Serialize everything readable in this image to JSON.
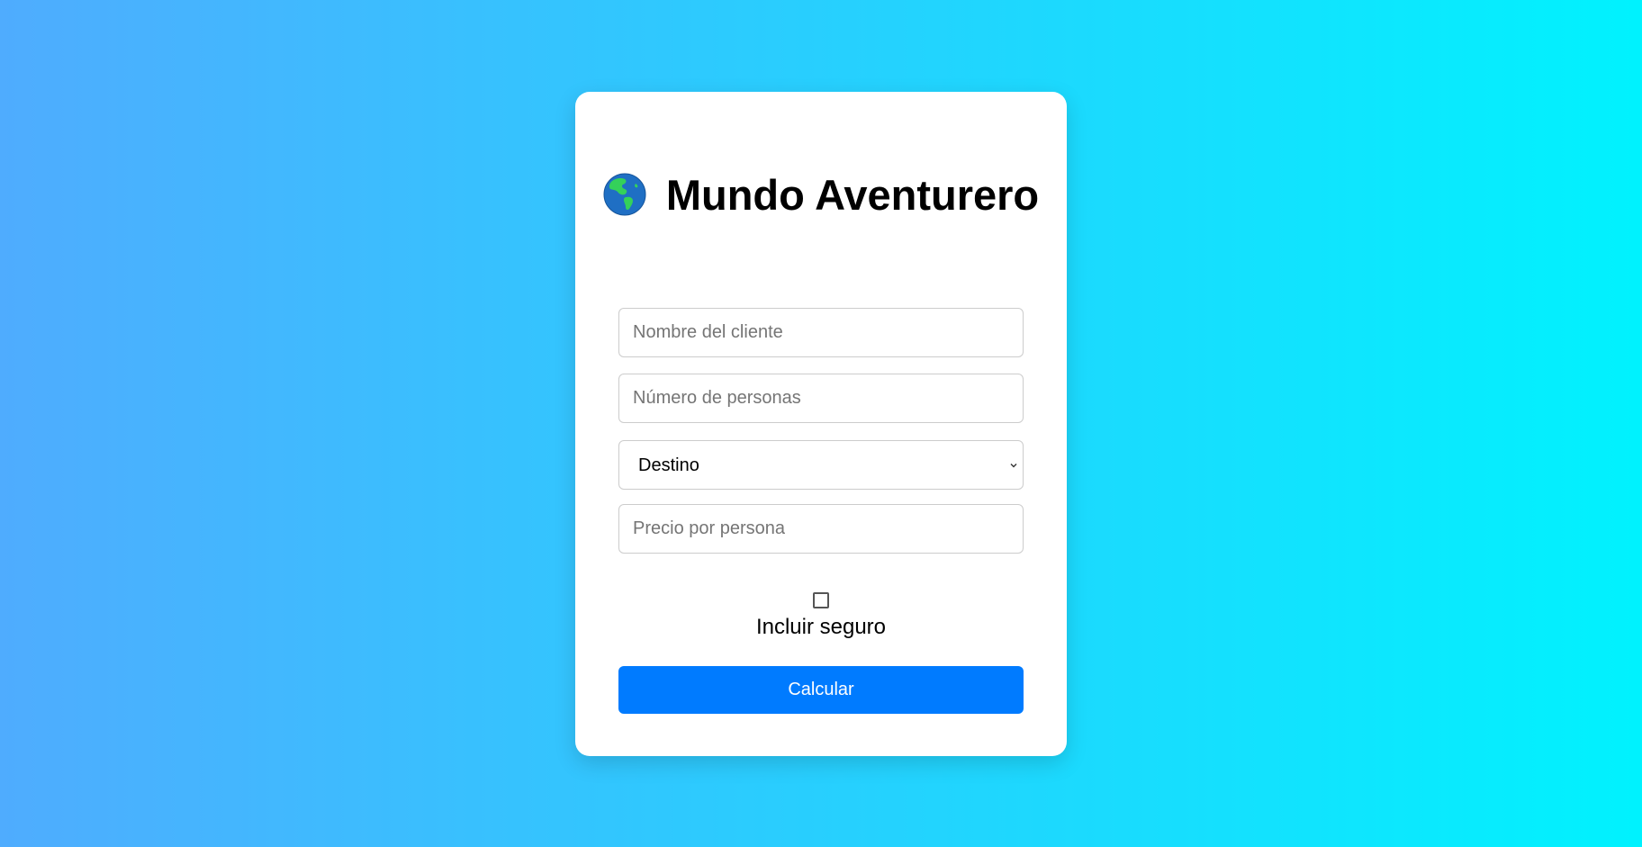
{
  "card": {
    "title": "Mundo Aventurero",
    "title_icon": "globe-americas-icon"
  },
  "form": {
    "client_name": {
      "placeholder": "Nombre del cliente",
      "value": ""
    },
    "people_count": {
      "placeholder": "Número de personas",
      "value": ""
    },
    "destination": {
      "selected": "Destino"
    },
    "price_per_person": {
      "placeholder": "Precio por persona",
      "value": ""
    },
    "insurance": {
      "label": "Incluir seguro",
      "checked": false
    },
    "submit_label": "Calcular"
  },
  "colors": {
    "background_start": "#4facfe",
    "background_end": "#00f2fe",
    "card": "#ffffff",
    "button": "#007bff",
    "button_text": "#ffffff"
  }
}
